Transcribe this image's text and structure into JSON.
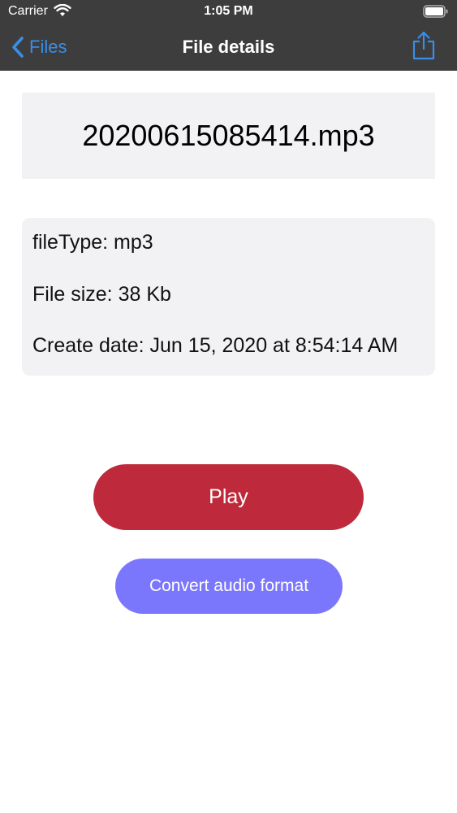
{
  "status_bar": {
    "carrier": "Carrier",
    "time": "1:05 PM",
    "wifi_icon": "wifi-icon",
    "battery_icon": "battery-icon"
  },
  "nav": {
    "back_label": "Files",
    "back_icon": "chevron-left-icon",
    "title": "File details",
    "share_icon": "share-icon"
  },
  "file": {
    "name": "20200615085414.mp3",
    "details": [
      "fileType: mp3",
      "File size: 38 Kb",
      "Create date: Jun 15, 2020 at 8:54:14 AM"
    ]
  },
  "actions": {
    "play_label": "Play",
    "convert_label": "Convert audio format"
  },
  "colors": {
    "nav_background": "#3d3d3e",
    "accent_blue": "#3a8ee6",
    "play_button": "#be2a3b",
    "convert_button": "#7b77fd",
    "card_background": "#f2f2f4"
  }
}
